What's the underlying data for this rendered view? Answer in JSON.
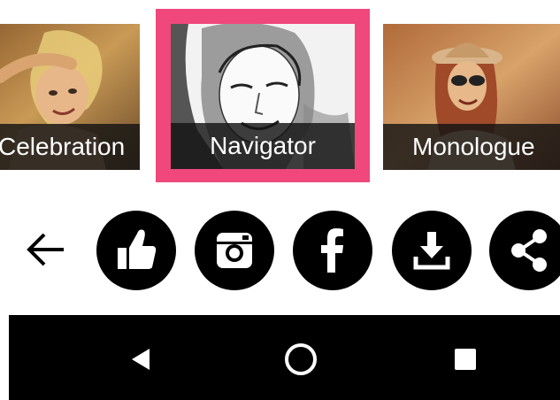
{
  "filters": [
    {
      "label": "Celebration",
      "selected": false
    },
    {
      "label": "Navigator",
      "selected": true
    },
    {
      "label": "Monologue",
      "selected": false
    }
  ],
  "colors": {
    "selection_border": "#f0487c",
    "action_button_bg": "#000000",
    "action_icon": "#ffffff",
    "nav_bar_bg": "#000000"
  },
  "actions": {
    "back": {
      "icon": "arrow-left-icon"
    },
    "buttons": [
      {
        "id": "like",
        "icon": "thumbs-up-icon"
      },
      {
        "id": "instagram",
        "icon": "instagram-icon"
      },
      {
        "id": "facebook",
        "icon": "facebook-icon"
      },
      {
        "id": "download",
        "icon": "download-icon"
      },
      {
        "id": "share",
        "icon": "share-icon"
      }
    ]
  },
  "system_nav": {
    "back": "triangle-back-icon",
    "home": "circle-home-icon",
    "recents": "square-recents-icon"
  }
}
